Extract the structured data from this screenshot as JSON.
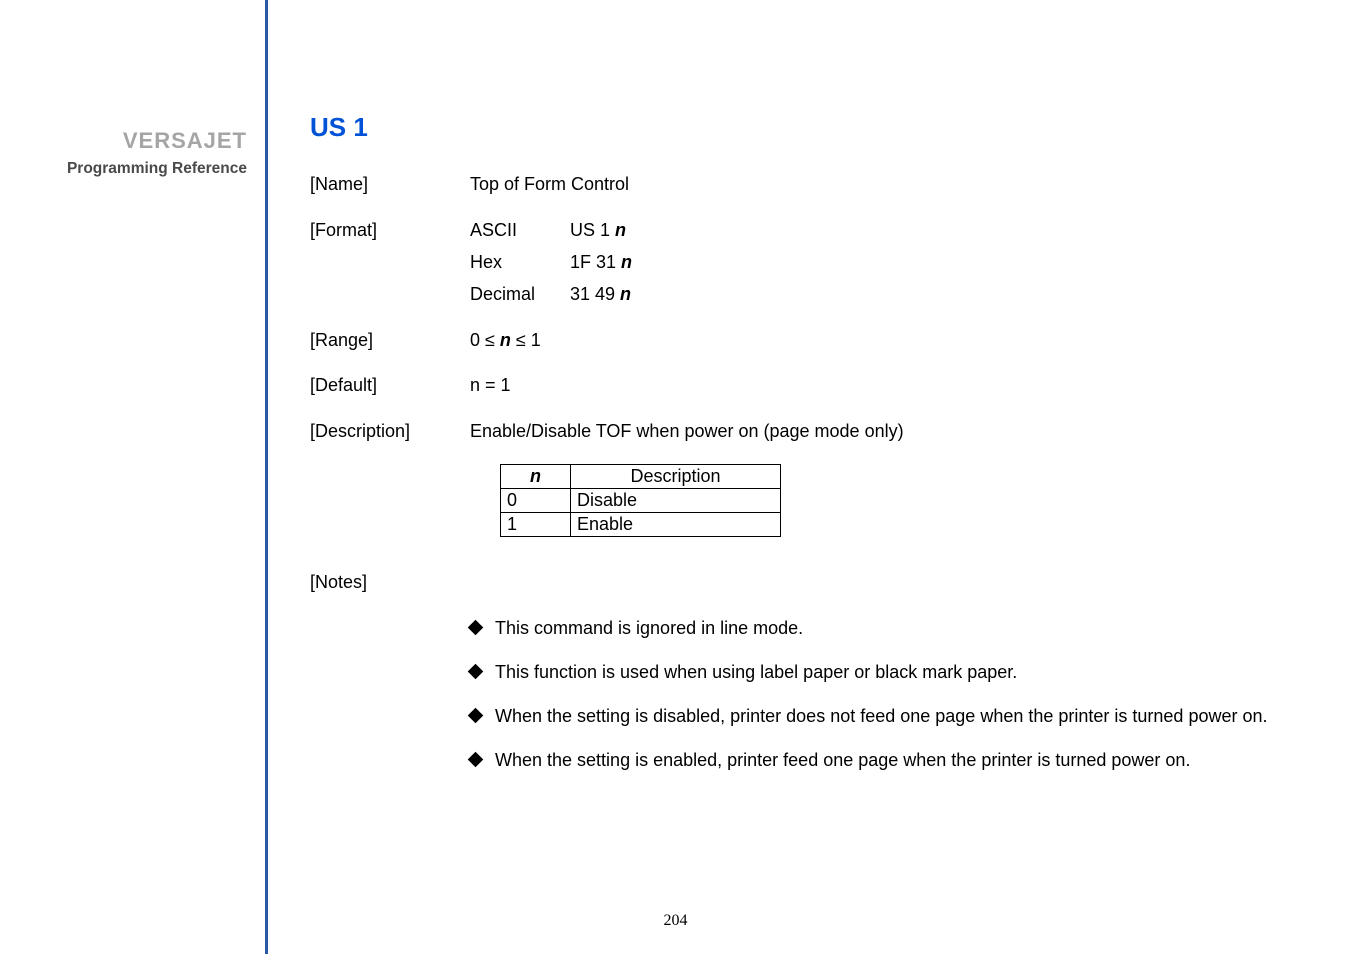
{
  "sidebar": {
    "brand": "VERSAJET",
    "subtitle": "Programming Reference"
  },
  "command": {
    "title": "US 1",
    "name_label": "[Name]",
    "name_value": "Top of Form Control",
    "format_label": "[Format]",
    "format": {
      "ascii_label": "ASCII",
      "ascii_value_prefix": "US 1 ",
      "hex_label": "Hex",
      "hex_value_prefix": "1F 31 ",
      "dec_label": "Decimal",
      "dec_value_prefix": "31 49 ",
      "n": "n"
    },
    "range_label": "[Range]",
    "range_prefix": "0 ≤ ",
    "range_n": "n",
    "range_suffix": " ≤ 1",
    "default_label": "[Default]",
    "default_value": "n = 1",
    "description_label": "[Description]",
    "description_value": "Enable/Disable TOF when power on (page mode only)",
    "table": {
      "header_n": "n",
      "header_desc": "Description",
      "rows": [
        {
          "n": "0",
          "desc": "Disable"
        },
        {
          "n": "1",
          "desc": "Enable"
        }
      ]
    },
    "notes_label": "[Notes]",
    "bullets": [
      "This command is ignored in line mode.",
      "This function is used when using label paper or black mark paper.",
      "When the setting is disabled, printer does not feed one page when the printer is turned power on.",
      "When the setting is enabled, printer feed one page when the printer is turned power on."
    ]
  },
  "page_number": "204"
}
